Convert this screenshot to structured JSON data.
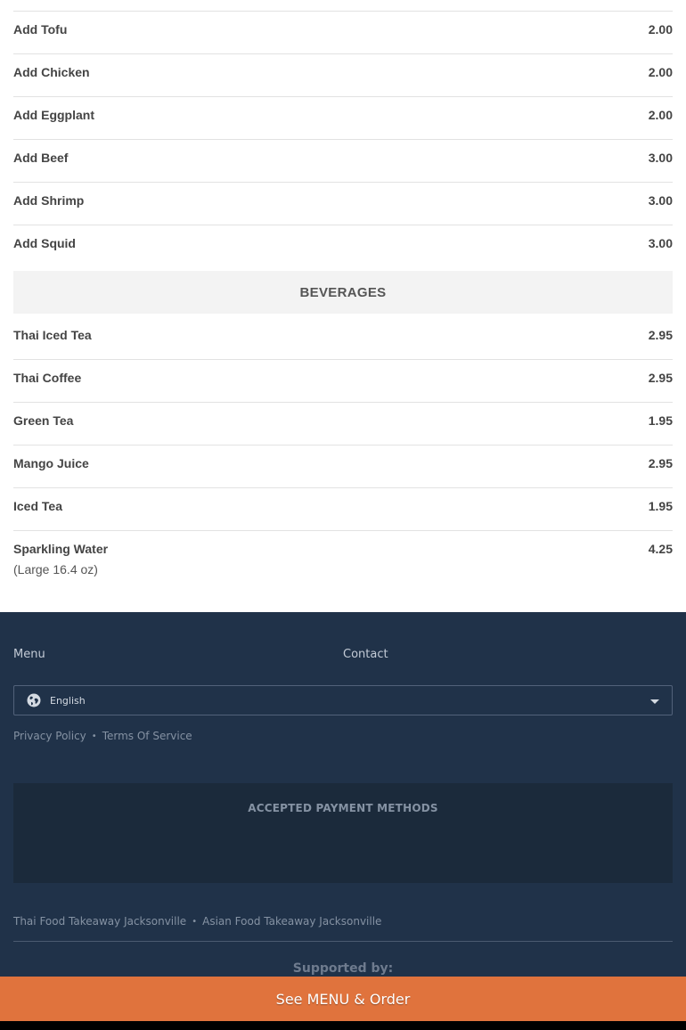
{
  "addons": [
    {
      "name": "Add Tofu",
      "price": "2.00"
    },
    {
      "name": "Add Chicken",
      "price": "2.00"
    },
    {
      "name": "Add Eggplant",
      "price": "2.00"
    },
    {
      "name": "Add Beef",
      "price": "3.00"
    },
    {
      "name": "Add Shrimp",
      "price": "3.00"
    },
    {
      "name": "Add Squid",
      "price": "3.00"
    }
  ],
  "beverages": {
    "title": "BEVERAGES",
    "items": [
      {
        "name": "Thai Iced Tea",
        "price": "2.95"
      },
      {
        "name": "Thai Coffee",
        "price": "2.95"
      },
      {
        "name": "Green Tea",
        "price": "1.95"
      },
      {
        "name": "Mango Juice",
        "price": "2.95"
      },
      {
        "name": "Iced Tea",
        "price": "1.95"
      },
      {
        "name": "Sparkling Water",
        "price": "4.25",
        "description": "(Large 16.4 oz)"
      }
    ]
  },
  "footer": {
    "nav": {
      "menu": "Menu",
      "contact": "Contact"
    },
    "language": {
      "selected": "English",
      "icon": "globe-icon"
    },
    "legal": {
      "privacy": "Privacy Policy",
      "terms": "Terms Of Service",
      "separator": "•"
    },
    "payments": {
      "title": "ACCEPTED PAYMENT METHODS"
    },
    "seo": {
      "link1": "Thai Food Takeaway Jacksonville",
      "link2": "Asian Food Takeaway Jacksonville",
      "separator": "•"
    },
    "supported_by": "Supported by:"
  },
  "cta": {
    "label": "See MENU & Order"
  },
  "colors": {
    "footer_bg": "#203249",
    "cta_bg": "#e0733d",
    "section_header_bg": "#f3f3f3"
  }
}
